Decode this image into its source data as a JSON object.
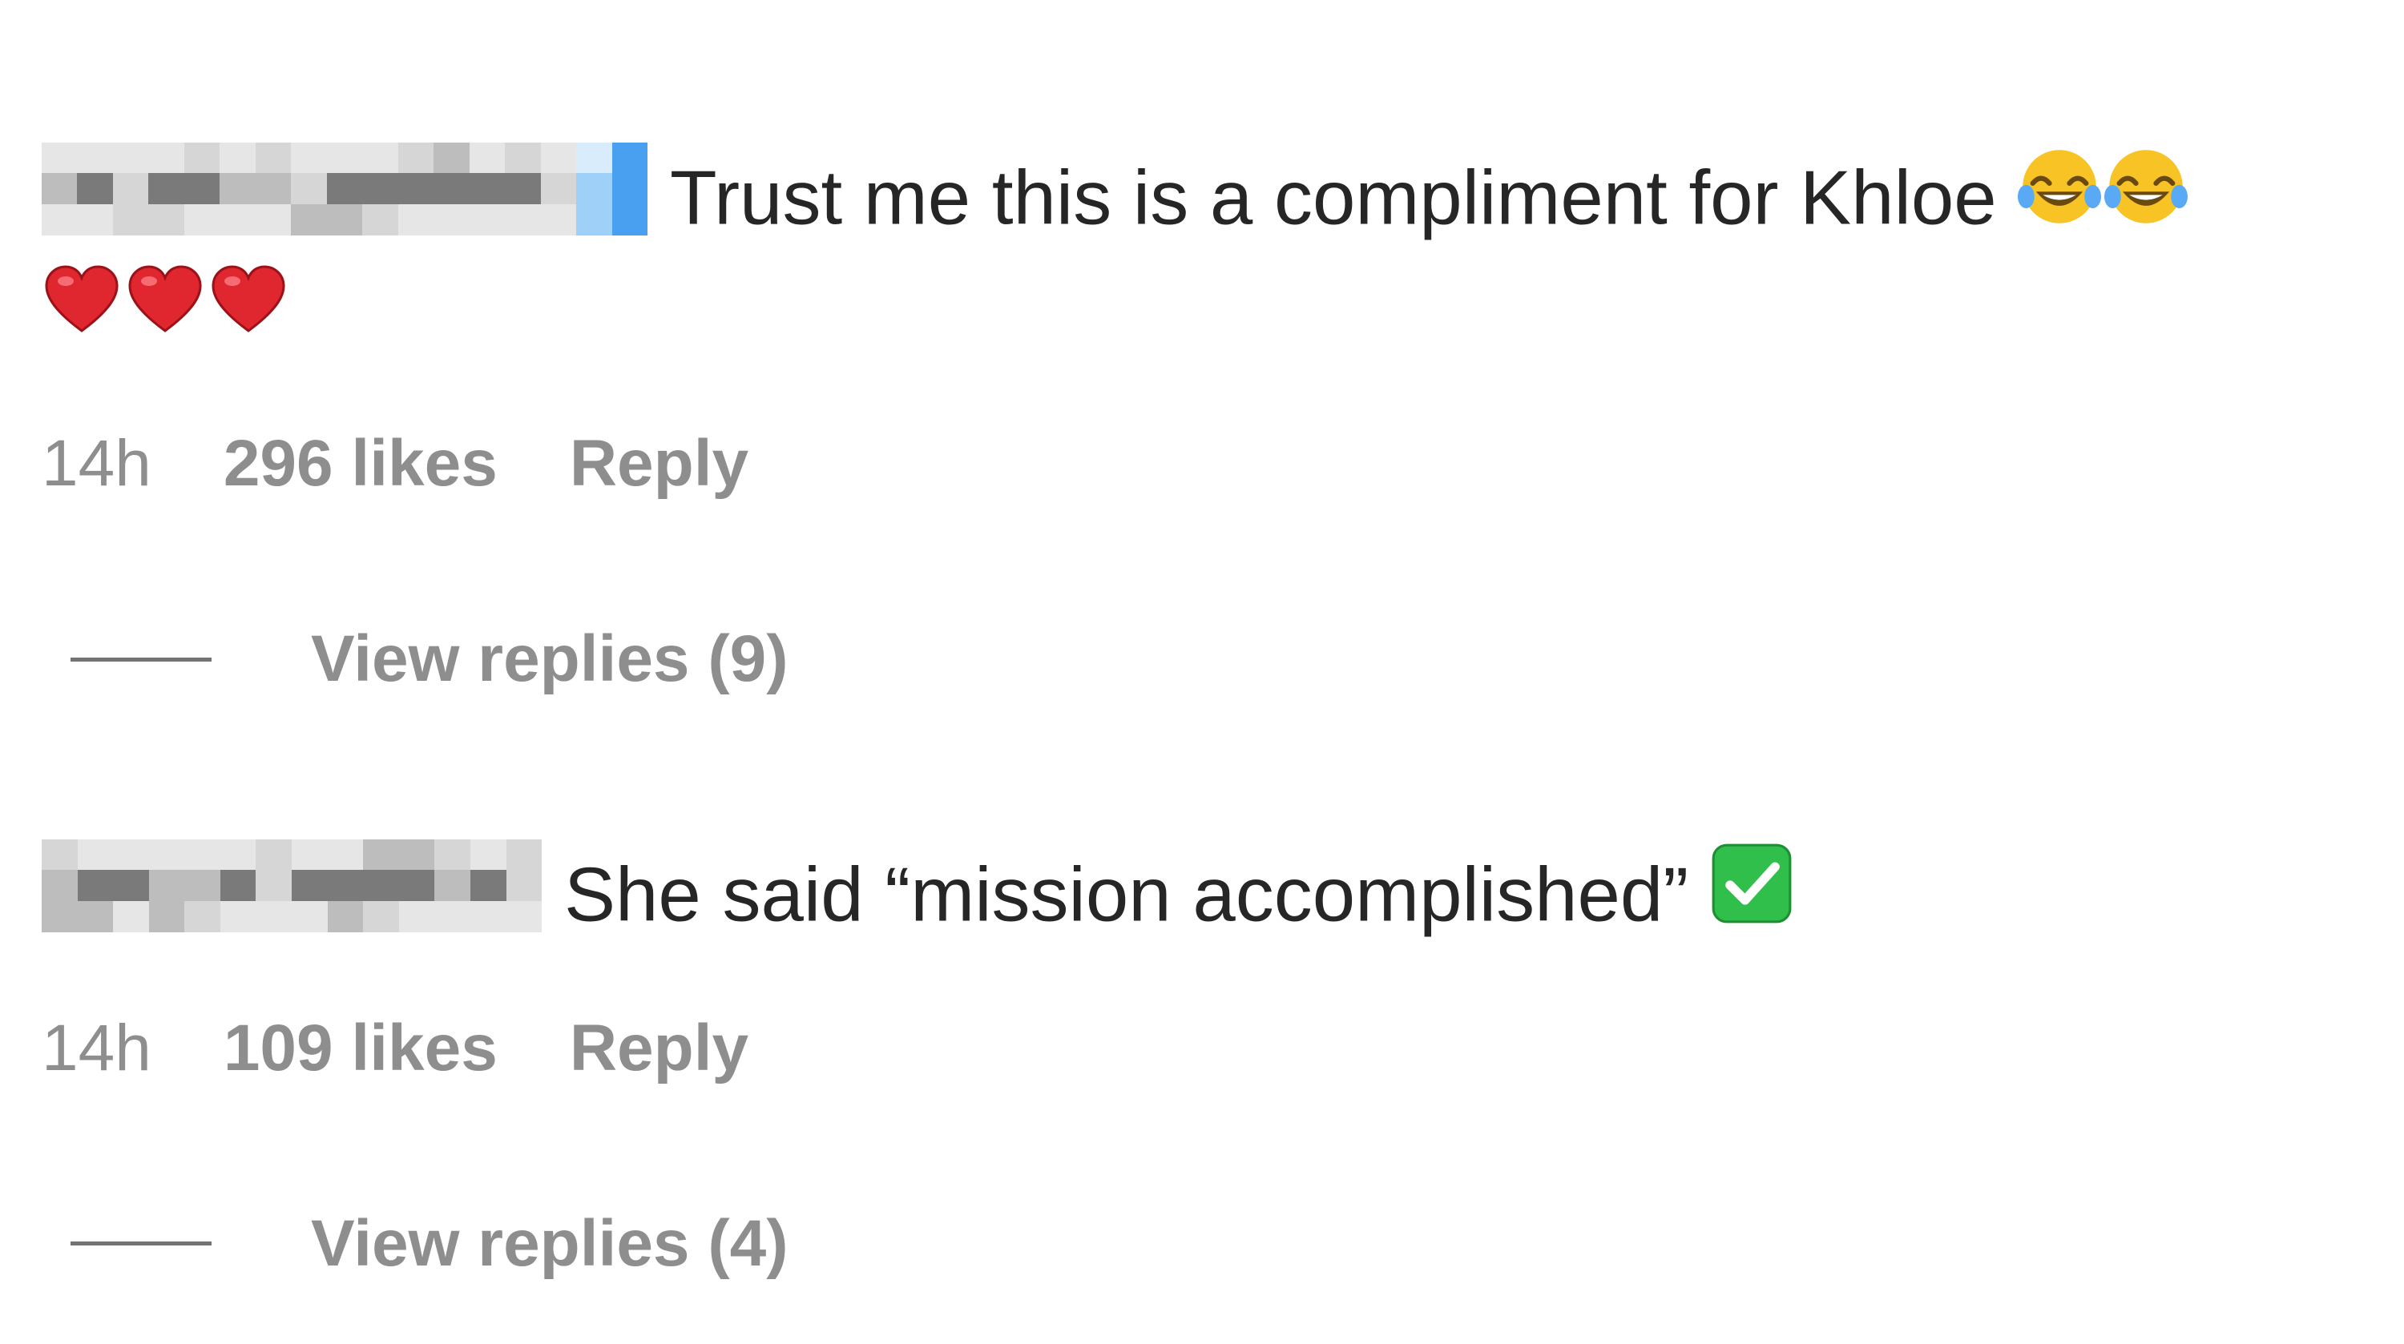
{
  "comments": [
    {
      "text": "Trust me this is a compliment for Khloe",
      "emojis": [
        "face-with-tears-of-joy",
        "face-with-tears-of-joy",
        "red-heart",
        "red-heart",
        "red-heart"
      ],
      "time": "14h",
      "likes": "296 likes",
      "reply_label": "Reply",
      "view_replies": "View replies (9)"
    },
    {
      "text": "She said “mission accomplished”",
      "emojis": [
        "check-mark-button"
      ],
      "time": "14h",
      "likes": "109 likes",
      "reply_label": "Reply",
      "view_replies": "View replies (4)"
    }
  ],
  "colors": {
    "text": "#262626",
    "secondary": "#8e8e8e",
    "divider": "#737373",
    "heart": "#e0262f",
    "check": "#2fbf4a",
    "laugh_face": "#f7c325",
    "tear": "#5aa9f5",
    "pixelated_username_tones": [
      "#e6e6e6",
      "#bdbdbd",
      "#7a7a7a",
      "#d6d6d6",
      "#4aa0f0"
    ]
  }
}
